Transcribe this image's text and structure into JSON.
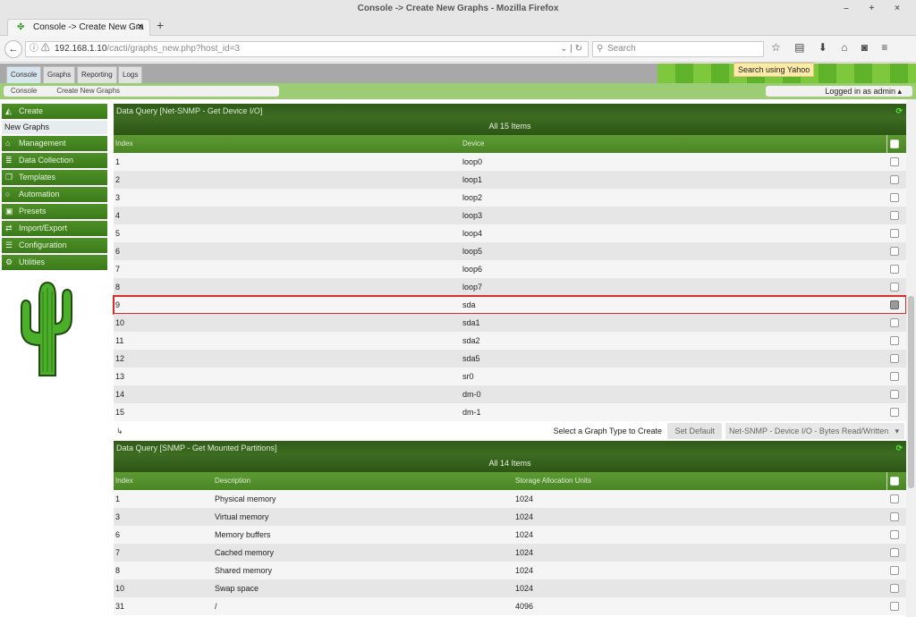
{
  "window": {
    "title": "Console -> Create New Graphs - Mozilla Firefox",
    "controls": "– + ×"
  },
  "browser": {
    "tab_title": "Console -> Create New Gra",
    "new_tab": "+",
    "url_host": "192.168.1.10",
    "url_path": "/cacti/graphs_new.php?host_id=3",
    "search_placeholder": "Search",
    "tooltip": "Search using Yahoo"
  },
  "cacti_tabs": [
    "Console",
    "Graphs",
    "Reporting",
    "Logs"
  ],
  "breadcrumb": [
    "Console",
    "Create New Graphs"
  ],
  "login": "Logged in as admin",
  "sidebar": {
    "create": "Create",
    "new_graphs": "New Graphs",
    "items": [
      "Management",
      "Data Collection",
      "Templates",
      "Automation",
      "Presets",
      "Import/Export",
      "Configuration",
      "Utilities"
    ]
  },
  "query1": {
    "title": "Data Query [Net-SNMP - Get Device I/O]",
    "count": "All 15 Items",
    "columns": [
      "Index",
      "Device"
    ],
    "rows": [
      [
        "1",
        "loop0"
      ],
      [
        "2",
        "loop1"
      ],
      [
        "3",
        "loop2"
      ],
      [
        "4",
        "loop3"
      ],
      [
        "5",
        "loop4"
      ],
      [
        "6",
        "loop5"
      ],
      [
        "7",
        "loop6"
      ],
      [
        "8",
        "loop7"
      ],
      [
        "9",
        "sda"
      ],
      [
        "10",
        "sda1"
      ],
      [
        "11",
        "sda2"
      ],
      [
        "12",
        "sda5"
      ],
      [
        "13",
        "sr0"
      ],
      [
        "14",
        "dm-0"
      ],
      [
        "15",
        "dm-1"
      ]
    ],
    "checked_index": "9",
    "graph_type_label": "Select a Graph Type to Create",
    "set_default": "Set Default",
    "graph_type": "Net-SNMP - Device I/O - Bytes Read/Written"
  },
  "query2": {
    "title": "Data Query [SNMP - Get Mounted Partitions]",
    "count": "All 14 Items",
    "columns": [
      "Index",
      "Description",
      "Storage Allocation Units"
    ],
    "rows": [
      [
        "1",
        "Physical memory",
        "1024"
      ],
      [
        "3",
        "Virtual memory",
        "1024"
      ],
      [
        "6",
        "Memory buffers",
        "1024"
      ],
      [
        "7",
        "Cached memory",
        "1024"
      ],
      [
        "8",
        "Shared memory",
        "1024"
      ],
      [
        "10",
        "Swap space",
        "1024"
      ],
      [
        "31",
        "/",
        "4096"
      ]
    ]
  }
}
